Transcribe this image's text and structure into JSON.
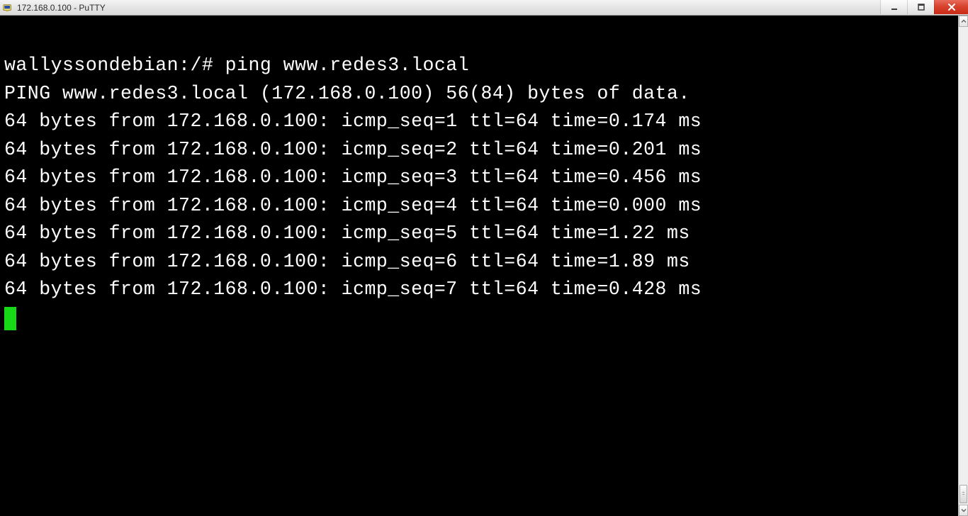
{
  "window": {
    "title": "172.168.0.100 - PuTTY"
  },
  "terminal": {
    "prompt": "wallyssondebian:/# ",
    "command": "ping www.redes3.local",
    "header": "PING www.redes3.local (172.168.0.100) 56(84) bytes of data.",
    "lines": [
      "64 bytes from 172.168.0.100: icmp_seq=1 ttl=64 time=0.174 ms",
      "64 bytes from 172.168.0.100: icmp_seq=2 ttl=64 time=0.201 ms",
      "64 bytes from 172.168.0.100: icmp_seq=3 ttl=64 time=0.456 ms",
      "64 bytes from 172.168.0.100: icmp_seq=4 ttl=64 time=0.000 ms",
      "64 bytes from 172.168.0.100: icmp_seq=5 ttl=64 time=1.22 ms",
      "64 bytes from 172.168.0.100: icmp_seq=6 ttl=64 time=1.89 ms",
      "64 bytes from 172.168.0.100: icmp_seq=7 ttl=64 time=0.428 ms"
    ]
  }
}
